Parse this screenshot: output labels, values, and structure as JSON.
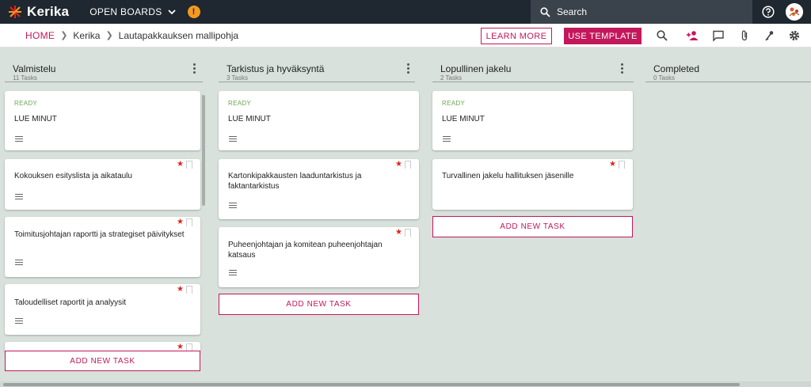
{
  "app": {
    "logo_text": "Kerika",
    "boards_label": "OPEN BOARDS",
    "notification_badge": "!",
    "search_placeholder": "Search"
  },
  "breadcrumb": {
    "home": "HOME",
    "org": "Kerika",
    "board": "Lautapakkauksen mallipohja"
  },
  "actions": {
    "learn_more": "LEARN MORE",
    "use_template": "USE TEMPLATE"
  },
  "toolbar_icons": [
    "search-icon",
    "add-person-icon",
    "chat-icon",
    "attachment-icon",
    "key-icon",
    "gear-icon"
  ],
  "colors": {
    "accent": "#c2185b",
    "topbar": "#1f2730",
    "board_bg": "#d8e1dc",
    "ready": "#6aa84f",
    "priority_star": "#e0241b"
  },
  "columns": [
    {
      "title": "Valmistelu",
      "count": "11 Tasks",
      "add_label": "ADD NEW TASK",
      "cards": [
        {
          "status": "READY",
          "title": "LUE MINUT",
          "priority": false
        },
        {
          "status": "",
          "title": "Kokouksen esityslista ja aikataulu",
          "priority": true
        },
        {
          "status": "",
          "title": "Toimitusjohtajan raportti ja strategiset päivitykset",
          "priority": true
        },
        {
          "status": "",
          "title": "Taloudelliset raportit ja analyysit",
          "priority": true
        }
      ]
    },
    {
      "title": "Tarkistus ja hyväksyntä",
      "count": "3 Tasks",
      "add_label": "ADD NEW TASK",
      "cards": [
        {
          "status": "READY",
          "title": "LUE MINUT",
          "priority": false
        },
        {
          "status": "",
          "title": "Kartonkipakkausten laaduntarkistus ja faktantarkistus",
          "priority": true
        },
        {
          "status": "",
          "title": "Puheenjohtajan ja komitean puheenjohtajan katsaus",
          "priority": true
        }
      ]
    },
    {
      "title": "Lopullinen jakelu",
      "count": "2 Tasks",
      "add_label": "ADD NEW TASK",
      "cards": [
        {
          "status": "READY",
          "title": "LUE MINUT",
          "priority": false
        },
        {
          "status": "",
          "title": "Turvallinen jakelu hallituksen jäsenille",
          "priority": true
        }
      ]
    },
    {
      "title": "Completed",
      "count": "0 Tasks",
      "cards": []
    }
  ]
}
